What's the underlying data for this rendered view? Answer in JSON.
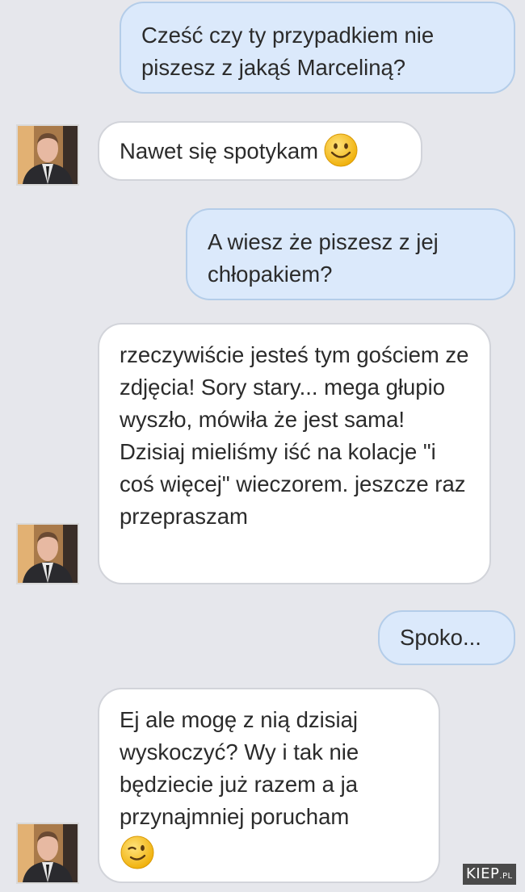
{
  "messages": [
    {
      "direction": "outgoing",
      "text": "Cześć czy ty przypadkiem nie piszesz z jakąś Marceliną?"
    },
    {
      "direction": "incoming",
      "text": "Nawet się spotykam",
      "emoji": "smiling-face-icon"
    },
    {
      "direction": "outgoing",
      "text": "A wiesz że piszesz z jej chłopakiem?"
    },
    {
      "direction": "incoming",
      "text": "rzeczywiście jesteś tym gościem ze zdjęcia! Sory stary... mega głupio wyszło, mówiła że jest sama! Dzisiaj mieliśmy iść na kolacje \"i coś więcej\" wieczorem. jeszcze raz przepraszam"
    },
    {
      "direction": "outgoing",
      "text": "Spoko..."
    },
    {
      "direction": "incoming",
      "text": "Ej ale mogę z nią dzisiaj wyskoczyć? Wy i tak nie będziecie już razem a ja przynajmniej porucham",
      "emoji": "winking-face-icon"
    }
  ],
  "watermark": {
    "main": "KIEP",
    "suffix": ".PL"
  },
  "colors": {
    "background": "#e6e7ec",
    "outgoing_bubble": "#dbe9fb",
    "incoming_bubble": "#ffffff",
    "text": "#2b2b2b",
    "emoji_face": "#f7c21c"
  }
}
